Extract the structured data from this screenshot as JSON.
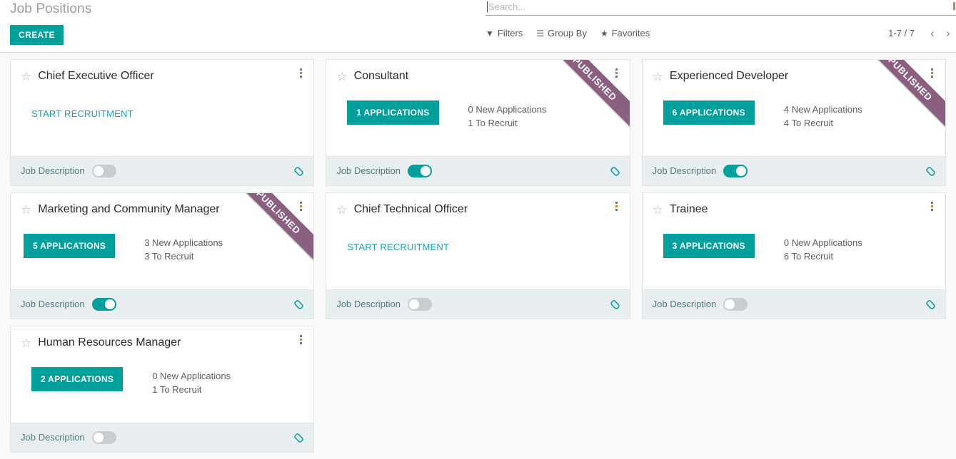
{
  "control_panel": {
    "breadcrumb": "Job Positions",
    "create_label": "CREATE",
    "search": {
      "placeholder": "Search...",
      "value": "",
      "toggle_icon": "caret-down-icon"
    },
    "filter_menus": [
      {
        "label": "Filters",
        "icon": "filter-icon"
      },
      {
        "label": "Group By",
        "icon": "list-icon"
      },
      {
        "label": "Favorites",
        "icon": "star-icon"
      }
    ],
    "pager": {
      "count": "1-7 / 7",
      "prev_icon": "chevron-left-icon",
      "next_icon": "chevron-right-icon"
    }
  },
  "kanban": {
    "footer_label": "Job Description",
    "recruit_label": "START RECRUITMENT",
    "ribbon_label": "PUBLISHED",
    "star_icon": "star-outline-icon",
    "kebab_icon": "vertical-dots-icon",
    "link_icon": "chain-link-icon",
    "accent_color": "#00a09d",
    "ribbon_color": "#8b5f80",
    "link_color": "#1aa1af",
    "cards": [
      {
        "title": "Chief Executive Officer",
        "published": false,
        "has_applications": false,
        "applications_label": "",
        "new_applications": "",
        "to_recruit": "",
        "job_description_on": false
      },
      {
        "title": "Consultant",
        "published": true,
        "has_applications": true,
        "applications_label": "1 APPLICATIONS",
        "new_applications": "0 New Applications",
        "to_recruit": "1 To Recruit",
        "job_description_on": true
      },
      {
        "title": "Experienced Developer",
        "published": true,
        "has_applications": true,
        "applications_label": "6 APPLICATIONS",
        "new_applications": "4 New Applications",
        "to_recruit": "4 To Recruit",
        "job_description_on": true
      },
      {
        "title": "Marketing and Community Manager",
        "published": true,
        "has_applications": true,
        "applications_label": "5 APPLICATIONS",
        "new_applications": "3 New Applications",
        "to_recruit": "3 To Recruit",
        "job_description_on": true
      },
      {
        "title": "Chief Technical Officer",
        "published": false,
        "has_applications": false,
        "applications_label": "",
        "new_applications": "",
        "to_recruit": "",
        "job_description_on": false
      },
      {
        "title": "Trainee",
        "published": false,
        "has_applications": true,
        "applications_label": "3 APPLICATIONS",
        "new_applications": "0 New Applications",
        "to_recruit": "6 To Recruit",
        "job_description_on": false
      },
      {
        "title": "Human Resources Manager",
        "published": false,
        "has_applications": true,
        "applications_label": "2 APPLICATIONS",
        "new_applications": "0 New Applications",
        "to_recruit": "1 To Recruit",
        "job_description_on": false
      }
    ]
  }
}
